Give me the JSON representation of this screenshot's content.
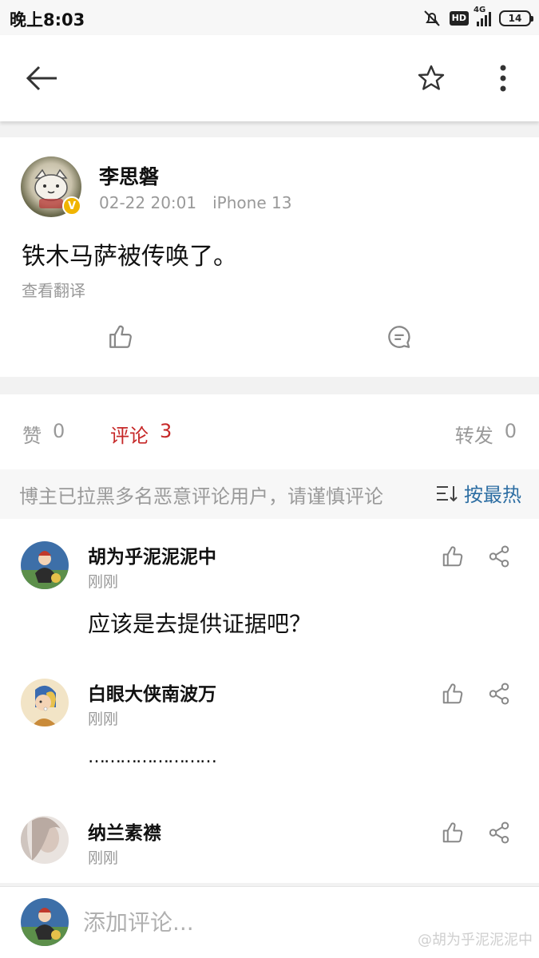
{
  "status_bar": {
    "time": "晚上8:03",
    "hd_label": "HD",
    "network_label": "4G",
    "battery_level": "14"
  },
  "post": {
    "author": "李思磐",
    "date": "02-22 20:01",
    "device": "iPhone 13",
    "text": "铁木马萨被传唤了。",
    "translate_label": "查看翻译"
  },
  "tabs": {
    "likes": {
      "label": "赞",
      "count": "0"
    },
    "comments": {
      "label": "评论",
      "count": "3"
    },
    "reposts": {
      "label": "转发",
      "count": "0"
    }
  },
  "notice": {
    "text": "博主已拉黑多名恶意评论用户，请谨慎评论",
    "sort_label": "按最热"
  },
  "comments": [
    {
      "name": "胡为乎泥泥泥中",
      "time": "刚刚",
      "text": "应该是去提供证据吧？"
    },
    {
      "name": "白眼大侠南波万",
      "time": "刚刚",
      "text": "……………………"
    },
    {
      "name": "纳兰素襟",
      "time": "刚刚",
      "text": ""
    }
  ],
  "composer": {
    "placeholder": "添加评论..."
  },
  "watermark": "@胡为乎泥泥泥中",
  "colors": {
    "accent": "#c62828",
    "link": "#2d6ea3",
    "verified": "#f0b400"
  },
  "icons": [
    "back-arrow-icon",
    "star-icon",
    "more-vert-icon",
    "thumb-up-icon",
    "comment-bubble-icon",
    "share-icon",
    "sort-icon",
    "verified-icon"
  ]
}
